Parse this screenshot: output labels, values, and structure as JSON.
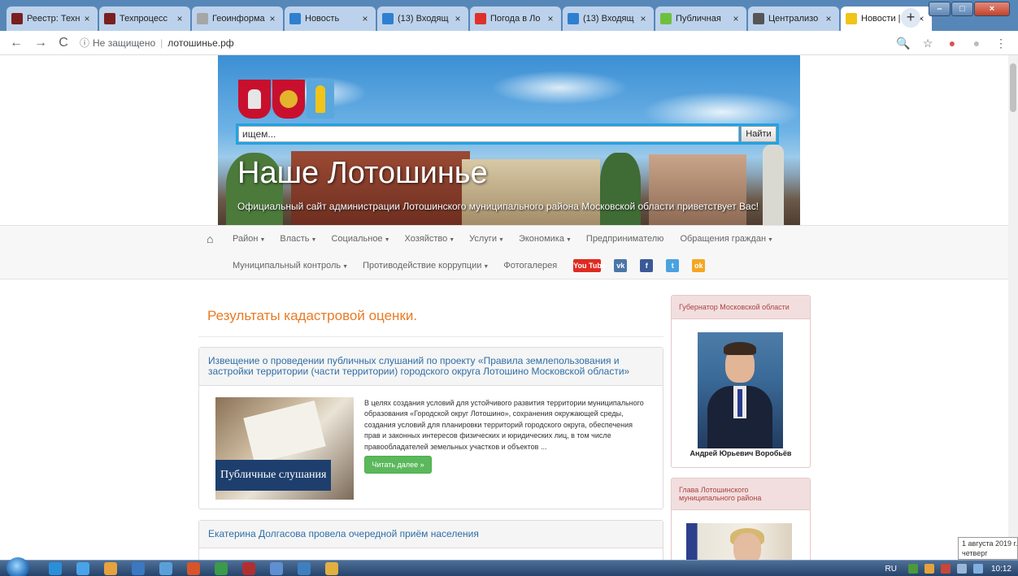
{
  "browser": {
    "tabs": [
      {
        "title": "Реестр: Техн",
        "favicon_color": "#7a1f1f",
        "active": false
      },
      {
        "title": "Техпроцесс",
        "favicon_color": "#7a1f1f",
        "active": false
      },
      {
        "title": "Геоинформа",
        "favicon_color": "#a6a6a6",
        "active": false
      },
      {
        "title": "Новость",
        "favicon_color": "#2f7fd0",
        "active": false
      },
      {
        "title": "(13) Входящ",
        "favicon_color": "#2f7fd0",
        "active": false
      },
      {
        "title": "Погода в Ло",
        "favicon_color": "#e0302a",
        "active": false
      },
      {
        "title": "(13) Входящ",
        "favicon_color": "#2f7fd0",
        "active": false
      },
      {
        "title": "Публичная",
        "favicon_color": "#6fbf3f",
        "active": false
      },
      {
        "title": "Централизо",
        "favicon_color": "#555555",
        "active": false
      },
      {
        "title": "Новости | О",
        "favicon_color": "#f0c419",
        "active": true
      }
    ],
    "close_glyph": "×",
    "new_tab_glyph": "+",
    "window_buttons": {
      "minimize": "–",
      "maximize": "□",
      "close": "×"
    },
    "nav": {
      "back": "←",
      "forward": "→",
      "reload": "C"
    },
    "address": {
      "info_glyph": "ⓘ",
      "security": "Не защищено",
      "separator": "|",
      "url": "лотошинье.рф"
    },
    "toolbar_icons": {
      "zoom": "🔍",
      "bookmark": "☆",
      "ext": "●",
      "profile": "●",
      "menu": "⋮"
    }
  },
  "header": {
    "search_placeholder": "ищем...",
    "search_button": "Найти",
    "site_title": "Наше Лотошинье",
    "site_subtitle": "Официальный сайт администрации Лотошинского муниципального района Московской области приветствует Вас!"
  },
  "nav": {
    "home_glyph": "⌂",
    "row1": [
      {
        "label": "Район",
        "caret": "▼"
      },
      {
        "label": "Власть",
        "caret": "▼"
      },
      {
        "label": "Социальное",
        "caret": "▼"
      },
      {
        "label": "Хозяйство",
        "caret": "▼"
      },
      {
        "label": "Услуги",
        "caret": "▼"
      },
      {
        "label": "Экономика",
        "caret": "▼"
      },
      {
        "label": "Предпринимателю",
        "caret": ""
      },
      {
        "label": "Обращения граждан",
        "caret": "▼"
      }
    ],
    "row2": [
      {
        "label": "Муниципальный контроль",
        "caret": "▼"
      },
      {
        "label": "Противодействие коррупции",
        "caret": "▼"
      },
      {
        "label": "Фотогалерея",
        "caret": ""
      }
    ],
    "social": {
      "youtube": "You Tube",
      "vk": "vk",
      "facebook": "f",
      "twitter": "t",
      "ok": "ok"
    }
  },
  "main": {
    "title": "Результаты кадастровой оценки.",
    "articles": [
      {
        "headline": "Извещение о проведении публичных слушаний по проекту «Правила землепользования и застройки территории (части территории) городского округа Лотошино Московской области»",
        "thumb_caption": "Публичные слушания",
        "excerpt": "В целях создания условий для устойчивого развития территории муниципального образования «Городской округ Лотошино», сохранения окружающей среды, создания условий для планировки территорий городского округа, обеспечения прав и законных интересов физических и юридических лиц, в том числе правообладателей земельных участков и объектов ...",
        "read_more": "Читать далее »"
      },
      {
        "headline": "Екатерина Долгасова провела очередной приём населения"
      }
    ]
  },
  "sidebar": {
    "governor_header": "Губернатор Московской области",
    "governor_name": "Андрей Юрьевич Воробьёв",
    "head_header": "Глава Лотошинского муниципального района"
  },
  "tooltip": {
    "date": "1 августа 2019 г.",
    "weekday": "четверг"
  },
  "taskbar": {
    "lang": "RU",
    "time": "10:12",
    "app_colors": [
      "#2a8fd8",
      "#4aa3e8",
      "#e6a23c",
      "#3b78c2",
      "#5aa0d8",
      "#d8542a",
      "#3a9a4a",
      "#b03030",
      "#5f8fd0",
      "#3f7fc0",
      "#e2b040"
    ]
  }
}
